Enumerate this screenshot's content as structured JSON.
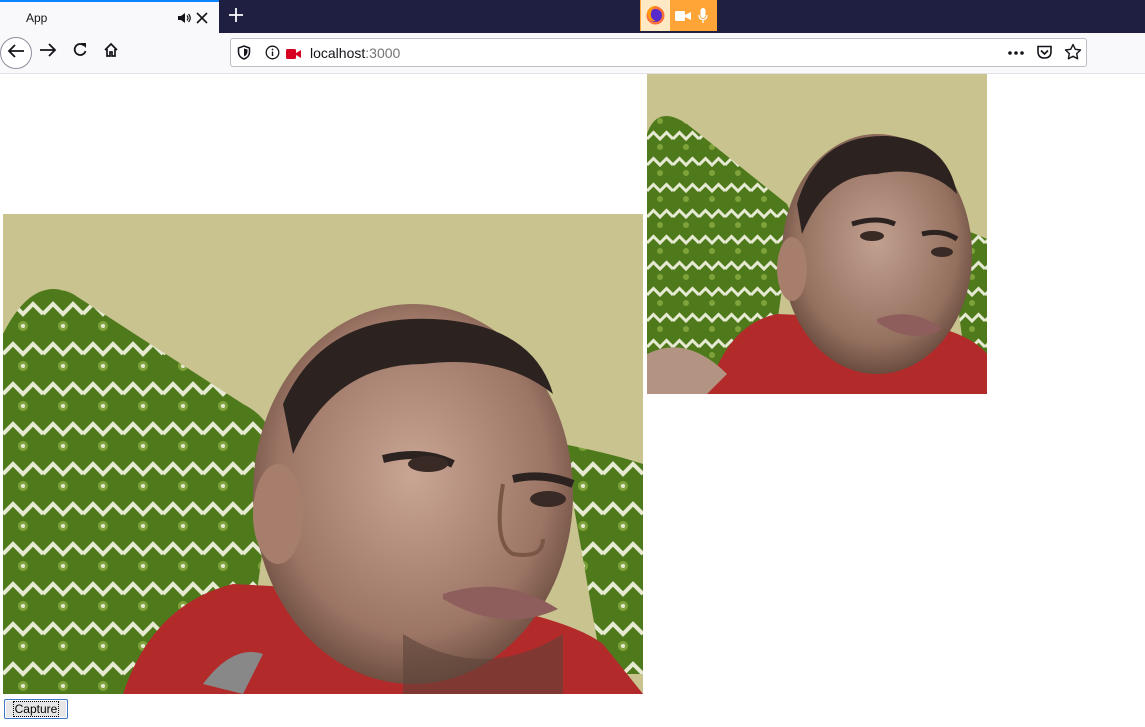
{
  "browser": {
    "tab": {
      "title": "App"
    },
    "url": {
      "host": "localhost",
      "port": ":3000"
    }
  },
  "page": {
    "capture_button_label": "Capture"
  },
  "colors": {
    "tabbar_bg": "#1f2041",
    "tab_accent": "#0a84ff",
    "media_indicator": "#ffa436",
    "camera_icon": "#d70022"
  },
  "icons": [
    "speaker-icon",
    "close-icon",
    "plus-icon",
    "firefox-icon",
    "camera-icon",
    "microphone-icon",
    "back-icon",
    "forward-icon",
    "reload-icon",
    "home-icon",
    "shield-icon",
    "info-icon",
    "camera-permission-icon",
    "more-icon",
    "pocket-icon",
    "star-icon"
  ]
}
